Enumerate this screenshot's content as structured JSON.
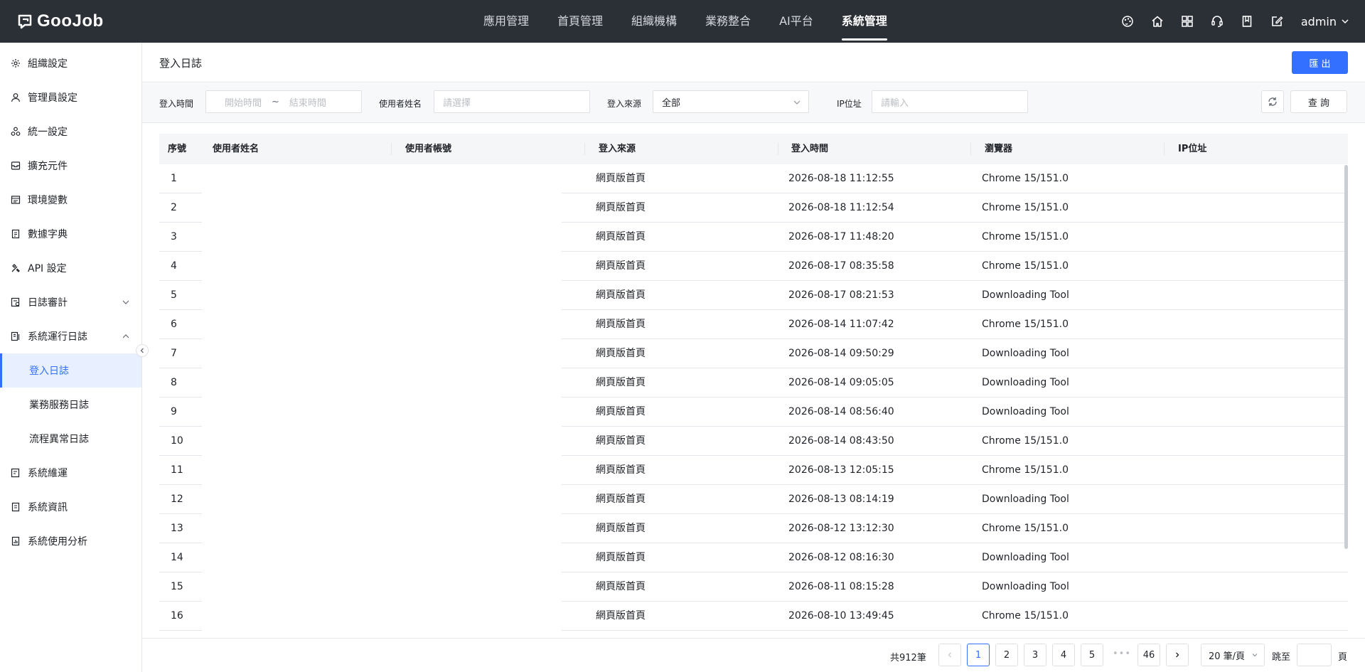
{
  "app": {
    "logo_text": "GooJob",
    "user": "admin"
  },
  "nav": [
    {
      "label": "應用管理",
      "active": false
    },
    {
      "label": "首頁管理",
      "active": false
    },
    {
      "label": "組織機構",
      "active": false
    },
    {
      "label": "業務整合",
      "active": false
    },
    {
      "label": "AI平台",
      "active": false
    },
    {
      "label": "系統管理",
      "active": true
    }
  ],
  "top_icons": [
    "palette-icon",
    "home-icon",
    "grid-icon",
    "headset-icon",
    "book-icon",
    "edit-icon"
  ],
  "sidebar": [
    {
      "label": "組織設定",
      "icon": "gear-icon"
    },
    {
      "label": "管理員設定",
      "icon": "user-icon"
    },
    {
      "label": "統一設定",
      "icon": "cluster-icon"
    },
    {
      "label": "擴充元件",
      "icon": "box-icon"
    },
    {
      "label": "環境變數",
      "icon": "terminal-icon"
    },
    {
      "label": "數據字典",
      "icon": "dictionary-icon"
    },
    {
      "label": "API 設定",
      "icon": "tools-icon"
    },
    {
      "label": "日誌審計",
      "icon": "audit-icon",
      "expanded": false
    },
    {
      "label": "系統運行日誌",
      "icon": "log-icon",
      "expanded": true
    },
    {
      "label": "登入日誌",
      "sub": true,
      "active": true
    },
    {
      "label": "業務服務日誌",
      "sub": true
    },
    {
      "label": "流程異常日誌",
      "sub": true
    },
    {
      "label": "系統維運",
      "icon": "maintenance-icon"
    },
    {
      "label": "系統資訊",
      "icon": "info-icon"
    },
    {
      "label": "系統使用分析",
      "icon": "analysis-icon"
    }
  ],
  "page": {
    "title": "登入日誌",
    "export_label": "匯 出"
  },
  "filters": {
    "login_time_label": "登入時間",
    "start_placeholder": "開始時間",
    "range_sep": "~",
    "end_placeholder": "結束時間",
    "username_label": "使用者姓名",
    "username_placeholder": "請選擇",
    "source_label": "登入來源",
    "source_value": "全部",
    "ip_label": "IP位址",
    "ip_placeholder": "請輸入",
    "query_label": "查 詢"
  },
  "table": {
    "headers": [
      "序號",
      "使用者姓名",
      "使用者帳號",
      "登入來源",
      "登入時間",
      "瀏覽器",
      "IP位址"
    ],
    "rows": [
      [
        "1",
        "",
        "",
        "網頁版首頁",
        "2026-08-18 11:12:55",
        "Chrome 15/151.0",
        ""
      ],
      [
        "2",
        "",
        "",
        "網頁版首頁",
        "2026-08-18 11:12:54",
        "Chrome 15/151.0",
        ""
      ],
      [
        "3",
        "",
        "",
        "網頁版首頁",
        "2026-08-17 11:48:20",
        "Chrome 15/151.0",
        ""
      ],
      [
        "4",
        "",
        "",
        "網頁版首頁",
        "2026-08-17 08:35:58",
        "Chrome 15/151.0",
        ""
      ],
      [
        "5",
        "",
        "",
        "網頁版首頁",
        "2026-08-17 08:21:53",
        "Downloading Tool",
        ""
      ],
      [
        "6",
        "",
        "",
        "網頁版首頁",
        "2026-08-14 11:07:42",
        "Chrome 15/151.0",
        ""
      ],
      [
        "7",
        "",
        "",
        "網頁版首頁",
        "2026-08-14 09:50:29",
        "Downloading Tool",
        ""
      ],
      [
        "8",
        "",
        "",
        "網頁版首頁",
        "2026-08-14 09:05:05",
        "Downloading Tool",
        ""
      ],
      [
        "9",
        "",
        "",
        "網頁版首頁",
        "2026-08-14 08:56:40",
        "Downloading Tool",
        ""
      ],
      [
        "10",
        "",
        "",
        "網頁版首頁",
        "2026-08-14 08:43:50",
        "Chrome 15/151.0",
        ""
      ],
      [
        "11",
        "",
        "",
        "網頁版首頁",
        "2026-08-13 12:05:15",
        "Chrome 15/151.0",
        ""
      ],
      [
        "12",
        "",
        "",
        "網頁版首頁",
        "2026-08-13 08:14:19",
        "Downloading Tool",
        ""
      ],
      [
        "13",
        "",
        "",
        "網頁版首頁",
        "2026-08-12 13:12:30",
        "Chrome 15/151.0",
        ""
      ],
      [
        "14",
        "",
        "",
        "網頁版首頁",
        "2026-08-12 08:16:30",
        "Downloading Tool",
        ""
      ],
      [
        "15",
        "",
        "",
        "網頁版首頁",
        "2026-08-11 08:15:28",
        "Downloading Tool",
        ""
      ],
      [
        "16",
        "",
        "",
        "網頁版首頁",
        "2026-08-10 13:49:45",
        "Chrome 15/151.0",
        ""
      ]
    ]
  },
  "pagination": {
    "total": "共912筆",
    "pages": [
      "1",
      "2",
      "3",
      "4",
      "5"
    ],
    "current": "1",
    "ellipsis": "•••",
    "last": "46",
    "page_size": "20 筆/頁",
    "jump_label": "跳至",
    "page_unit": "頁"
  }
}
